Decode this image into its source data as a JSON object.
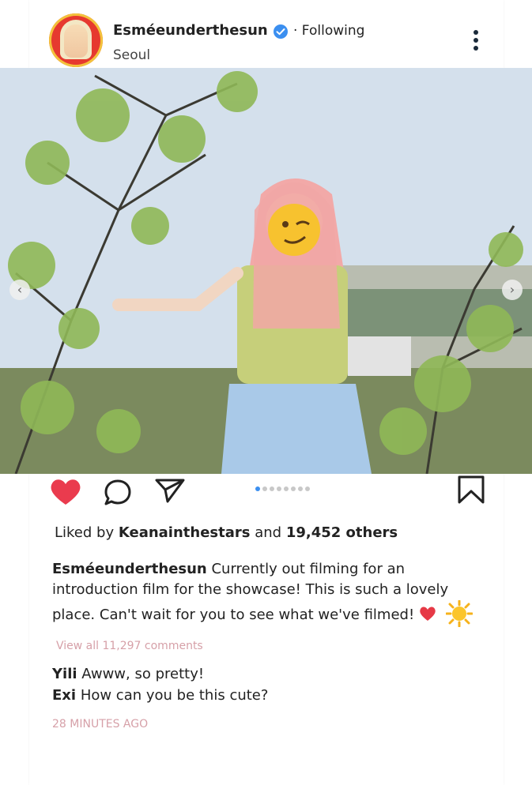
{
  "post": {
    "username": "Esméeunderthesun",
    "following_label": "· Following",
    "location": "Seoul",
    "carousel": {
      "total": 8,
      "active": 1
    }
  },
  "engagement": {
    "liked_by_prefix": "Liked by",
    "liked_by_user": "Keanainthestars",
    "and": "and",
    "others_count": "19,452 others"
  },
  "caption": {
    "username": "Esméeunderthesun",
    "text": "Currently out filming for an introduction film for the showcase! This is such a lovely place. Can't wait for you to see what we've filmed!"
  },
  "comments": {
    "view_all": "View all 11,297 comments",
    "items": [
      {
        "user": "Yili",
        "text": "Awww, so pretty!"
      },
      {
        "user": "Exi",
        "text": "How can you be this cute?"
      }
    ]
  },
  "timestamp": "28 MINUTES AGO",
  "icons": {
    "verified": "verified-badge-icon",
    "more": "more-options-icon",
    "like": "heart-icon",
    "comment": "comment-icon",
    "share": "share-icon",
    "save": "bookmark-icon"
  },
  "colors": {
    "like": "#ea3b4e",
    "verified": "#3b8ff0",
    "muted_pink": "#d6a0a8",
    "dot_active": "#3b8ff0"
  }
}
